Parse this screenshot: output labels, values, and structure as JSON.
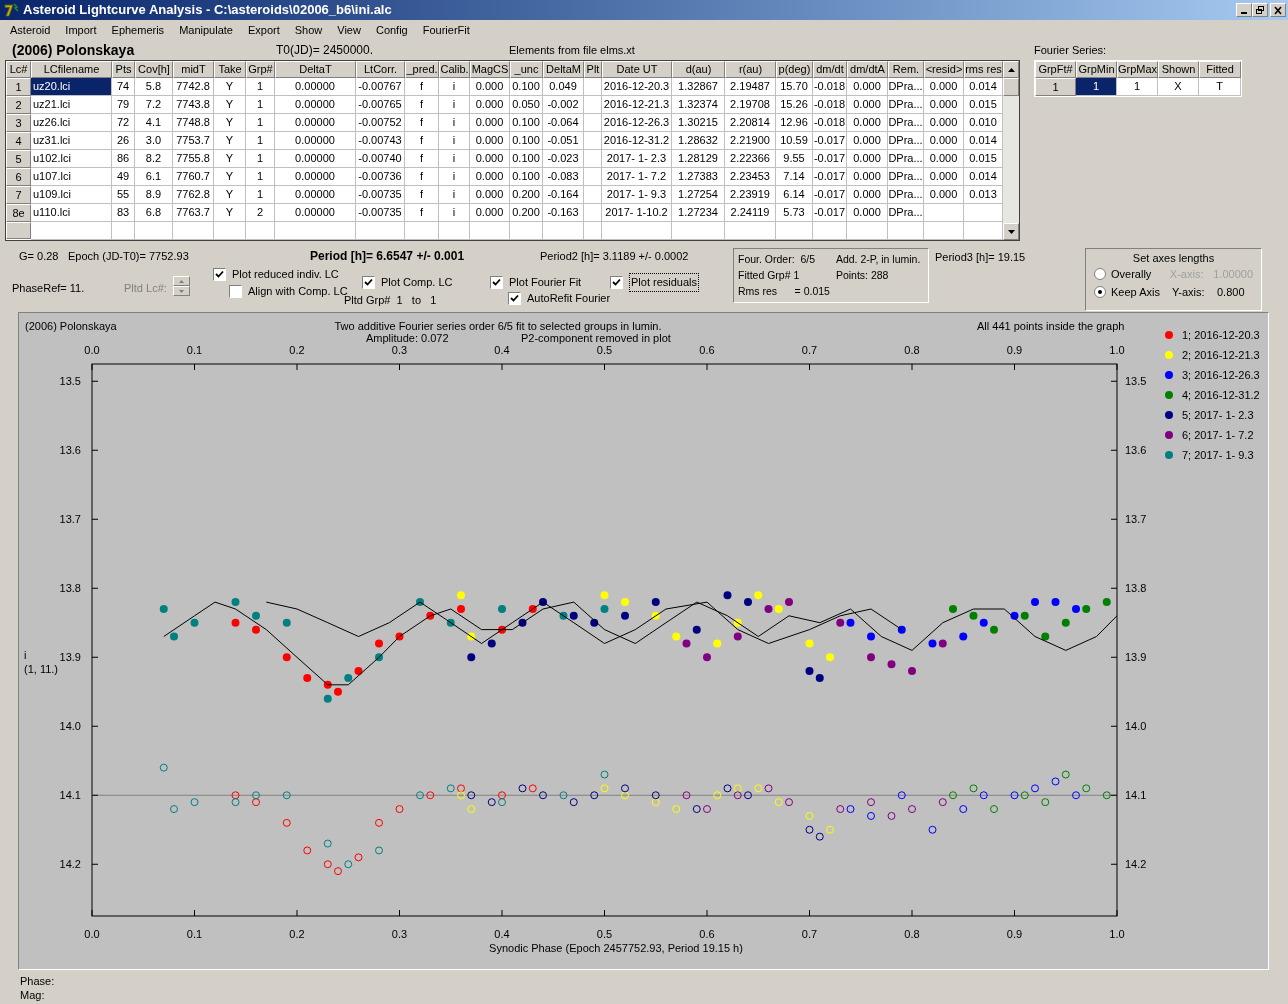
{
  "window": {
    "title": "Asteroid Lightcurve Analysis - C:\\asteroids\\02006_b6\\ini.alc"
  },
  "menu": [
    "Asteroid",
    "Import",
    "Ephemeris",
    "Manipulate",
    "Export",
    "Show",
    "View",
    "Config",
    "FourierFit"
  ],
  "header": {
    "object": "(2006) Polonskaya",
    "t0": "T0(JD)= 2450000.",
    "elements": "Elements from file elms.xt"
  },
  "table": {
    "columns": [
      "Lc#",
      "LCfilename",
      "Pts",
      "Cov[h]",
      "midT",
      "Take",
      "Grp#",
      "DeltaT",
      "LtCorr.",
      "_pred.",
      "Calib.",
      "MagCS",
      "_unc",
      "DeltaM",
      "Plt",
      "Date UT",
      "d(au)",
      "r(au)",
      "p(deg)",
      "dm/dt",
      "dm/dtA",
      "Rem.",
      "<resid>",
      "rms res"
    ],
    "rows": [
      {
        "selected": true,
        "cells": [
          "1",
          "uz20.lci",
          "74",
          "5.8",
          "7742.8",
          "Y",
          "1",
          "0.00000",
          "-0.00767",
          "f",
          "i",
          "0.000",
          "0.100",
          "0.049",
          "",
          "2016-12-20.3",
          "1.32867",
          "2.19487",
          "15.70",
          "-0.018",
          "0.000",
          "DPra...",
          "0.000",
          "0.014"
        ]
      },
      {
        "selected": false,
        "cells": [
          "2",
          "uz21.lci",
          "79",
          "7.2",
          "7743.8",
          "Y",
          "1",
          "0.00000",
          "-0.00765",
          "f",
          "i",
          "0.000",
          "0.050",
          "-0.002",
          "",
          "2016-12-21.3",
          "1.32374",
          "2.19708",
          "15.26",
          "-0.018",
          "0.000",
          "DPra...",
          "0.000",
          "0.015"
        ]
      },
      {
        "selected": false,
        "cells": [
          "3",
          "uz26.lci",
          "72",
          "4.1",
          "7748.8",
          "Y",
          "1",
          "0.00000",
          "-0.00752",
          "f",
          "i",
          "0.000",
          "0.100",
          "-0.064",
          "",
          "2016-12-26.3",
          "1.30215",
          "2.20814",
          "12.96",
          "-0.018",
          "0.000",
          "DPra...",
          "0.000",
          "0.010"
        ]
      },
      {
        "selected": false,
        "cells": [
          "4",
          "uz31.lci",
          "26",
          "3.0",
          "7753.7",
          "Y",
          "1",
          "0.00000",
          "-0.00743",
          "f",
          "i",
          "0.000",
          "0.100",
          "-0.051",
          "",
          "2016-12-31.2",
          "1.28632",
          "2.21900",
          "10.59",
          "-0.017",
          "0.000",
          "DPra...",
          "0.000",
          "0.014"
        ]
      },
      {
        "selected": false,
        "cells": [
          "5",
          "u102.lci",
          "86",
          "8.2",
          "7755.8",
          "Y",
          "1",
          "0.00000",
          "-0.00740",
          "f",
          "i",
          "0.000",
          "0.100",
          "-0.023",
          "",
          "2017- 1- 2.3",
          "1.28129",
          "2.22366",
          "9.55",
          "-0.017",
          "0.000",
          "DPra...",
          "0.000",
          "0.015"
        ]
      },
      {
        "selected": false,
        "cells": [
          "6",
          "u107.lci",
          "49",
          "6.1",
          "7760.7",
          "Y",
          "1",
          "0.00000",
          "-0.00736",
          "f",
          "i",
          "0.000",
          "0.100",
          "-0.083",
          "",
          "2017- 1- 7.2",
          "1.27383",
          "2.23453",
          "7.14",
          "-0.017",
          "0.000",
          "DPra...",
          "0.000",
          "0.014"
        ]
      },
      {
        "selected": false,
        "cells": [
          "7",
          "u109.lci",
          "55",
          "8.9",
          "7762.8",
          "Y",
          "1",
          "0.00000",
          "-0.00735",
          "f",
          "i",
          "0.000",
          "0.200",
          "-0.164",
          "",
          "2017- 1- 9.3",
          "1.27254",
          "2.23919",
          "6.14",
          "-0.017",
          "0.000",
          "DPra...",
          "0.000",
          "0.013"
        ]
      },
      {
        "selected": false,
        "cells": [
          "8e",
          "u110.lci",
          "83",
          "6.8",
          "7763.7",
          "Y",
          "2",
          "0.00000",
          "-0.00735",
          "f",
          "i",
          "0.000",
          "0.200",
          "-0.163",
          "",
          "2017- 1-10.2",
          "1.27234",
          "2.24119",
          "5.73",
          "-0.017",
          "0.000",
          "DPra...",
          "",
          ""
        ]
      }
    ]
  },
  "fourier": {
    "label": "Fourier Series:",
    "columns": [
      "GrpFt#",
      "GrpMin",
      "GrpMax",
      "Shown",
      "Fitted"
    ],
    "row": {
      "head": "1",
      "cells": [
        {
          "text": "1",
          "selected": true
        },
        {
          "text": "1",
          "selected": false
        },
        {
          "text": "X",
          "selected": false
        },
        {
          "text": "T",
          "selected": false
        }
      ]
    }
  },
  "info": {
    "g": "G= 0.28",
    "epoch": "Epoch (JD-T0)= 7752.93",
    "period": "Period [h]= 6.6547 +/- 0.001",
    "period2": "Period2 [h]= 3.1189 +/- 0.0002",
    "period3": "Period3 [h]= 19.15",
    "phaseref": "PhaseRef= 11.",
    "pltd_lc": {
      "label": "Pltd Lc#:",
      "disabled": true
    },
    "pltd_grp": "Pltd Grp#  1   to   1"
  },
  "checkboxes": [
    {
      "label": "Plot reduced indiv. LC",
      "checked": true
    },
    {
      "label": "Align with Comp. LC",
      "checked": false
    },
    {
      "label": "Plot Comp. LC",
      "checked": true
    },
    {
      "label": "Plot Fourier Fit",
      "checked": true
    },
    {
      "label": "AutoRefit Fourier",
      "checked": true
    },
    {
      "label": "Plot residuals",
      "checked": true
    }
  ],
  "fit_box": {
    "left": [
      "Four. Order:  6/5",
      "Fitted Grp# 1",
      "Rms res      = 0.015"
    ],
    "right": [
      "Add. 2-P, in lumin.",
      "Points: 288"
    ]
  },
  "axes": {
    "title": "Set axes lengths",
    "radios": [
      {
        "label": "Overally",
        "selected": false
      },
      {
        "label": "Keep Axis",
        "selected": true
      }
    ],
    "fields": [
      {
        "label": "X-axis:",
        "value": "1.00000",
        "disabled": true
      },
      {
        "label": "Y-axis:",
        "value": "0.800",
        "disabled": false
      }
    ]
  },
  "chart": {
    "chart_data": {
      "type": "scatter",
      "title": "Two additive Fourier series order 6/5 fit to selected groups in lumin.",
      "xlabel": "Synodic Phase (Epoch 2457752.93, Period 19.15 h)",
      "legend": "right",
      "xlim": [
        0,
        1
      ],
      "ylim": [
        14.275,
        13.475
      ],
      "xticks": [
        {
          "value": 0,
          "label": "0.0"
        },
        {
          "value": 0.1,
          "label": "0.1"
        },
        {
          "value": 0.2,
          "label": "0.2"
        },
        {
          "value": 0.3,
          "label": "0.3"
        },
        {
          "value": 0.4,
          "label": "0.4"
        },
        {
          "value": 0.5,
          "label": "0.5"
        },
        {
          "value": 0.6,
          "label": "0.6"
        },
        {
          "value": 0.7,
          "label": "0.7"
        },
        {
          "value": 0.8,
          "label": "0.8"
        },
        {
          "value": 0.9,
          "label": "0.9"
        },
        {
          "value": 1,
          "label": "1.0"
        }
      ],
      "yticks": [
        {
          "value": 13.5,
          "label": "13.5"
        },
        {
          "value": 13.6,
          "label": "13.6"
        },
        {
          "value": 13.7,
          "label": "13.7"
        },
        {
          "value": 13.8,
          "label": "13.8"
        },
        {
          "value": 13.9,
          "label": "13.9"
        },
        {
          "value": 14.0,
          "label": "14.0"
        },
        {
          "value": 14.1,
          "label": "14.1"
        },
        {
          "value": 14.2,
          "label": "14.2"
        }
      ],
      "annotations": [
        "(2006) Polonskaya",
        "Amplitude: 0.072",
        "P2-component removed in plot",
        "All 441 points inside the graph",
        "i",
        "(1, 11.)"
      ],
      "series": [
        {
          "type": "scatter",
          "name": "1; 2016-12-20.3",
          "color": "#ff0000",
          "x": [
            0.14,
            0.16,
            0.19,
            0.21,
            0.23,
            0.24,
            0.26,
            0.28,
            0.3,
            0.33,
            0.36,
            0.4,
            0.43
          ],
          "values": [
            13.85,
            13.86,
            13.9,
            13.93,
            13.94,
            13.95,
            13.92,
            13.88,
            13.87,
            13.84,
            13.83,
            13.86,
            13.83
          ]
        },
        {
          "type": "scatter",
          "name": "2; 2016-12-21.3",
          "color": "#ffff00",
          "x": [
            0.36,
            0.37,
            0.5,
            0.52,
            0.55,
            0.57,
            0.61,
            0.63,
            0.65,
            0.67,
            0.7,
            0.72
          ],
          "values": [
            13.81,
            13.87,
            13.81,
            13.82,
            13.84,
            13.87,
            13.88,
            13.85,
            13.81,
            13.83,
            13.88,
            13.9
          ]
        },
        {
          "type": "scatter",
          "name": "3; 2016-12-26.3",
          "color": "#0000ff",
          "x": [
            0.74,
            0.76,
            0.79,
            0.82,
            0.85,
            0.87,
            0.9,
            0.92,
            0.94,
            0.96
          ],
          "values": [
            13.85,
            13.87,
            13.86,
            13.88,
            13.87,
            13.85,
            13.84,
            13.82,
            13.82,
            13.83
          ]
        },
        {
          "type": "scatter",
          "name": "4; 2016-12-31.2",
          "color": "#008000",
          "x": [
            0.84,
            0.86,
            0.88,
            0.91,
            0.93,
            0.95,
            0.97,
            0.99
          ],
          "values": [
            13.83,
            13.84,
            13.86,
            13.84,
            13.87,
            13.85,
            13.83,
            13.82
          ]
        },
        {
          "type": "scatter",
          "name": "5; 2017- 1- 2.3",
          "color": "#000080",
          "x": [
            0.37,
            0.39,
            0.42,
            0.44,
            0.47,
            0.49,
            0.52,
            0.55,
            0.59,
            0.62,
            0.64,
            0.7,
            0.71
          ],
          "values": [
            13.9,
            13.88,
            13.85,
            13.82,
            13.84,
            13.85,
            13.84,
            13.82,
            13.86,
            13.81,
            13.82,
            13.92,
            13.93
          ]
        },
        {
          "type": "scatter",
          "name": "6; 2017- 1- 7.2",
          "color": "#800080",
          "x": [
            0.58,
            0.6,
            0.63,
            0.66,
            0.68,
            0.73,
            0.76,
            0.78,
            0.8,
            0.83
          ],
          "values": [
            13.88,
            13.9,
            13.87,
            13.83,
            13.82,
            13.85,
            13.9,
            13.91,
            13.92,
            13.88
          ]
        },
        {
          "type": "scatter",
          "name": "7; 2017- 1- 9.3",
          "color": "#008080",
          "x": [
            0.07,
            0.08,
            0.1,
            0.14,
            0.16,
            0.19,
            0.23,
            0.25,
            0.28,
            0.32,
            0.35,
            0.4,
            0.46,
            0.5
          ],
          "values": [
            13.83,
            13.87,
            13.85,
            13.82,
            13.84,
            13.85,
            13.96,
            13.93,
            13.9,
            13.82,
            13.85,
            13.83,
            13.84,
            13.83
          ]
        },
        {
          "type": "scatter",
          "color": "#ff0000",
          "x": [
            0.14,
            0.16,
            0.19,
            0.21,
            0.23,
            0.24,
            0.26,
            0.28,
            0.3,
            0.33,
            0.36,
            0.4,
            0.43
          ],
          "values": [
            14.1,
            14.11,
            14.14,
            14.18,
            14.2,
            14.21,
            14.19,
            14.14,
            14.12,
            14.1,
            14.09,
            14.1,
            14.09
          ]
        },
        {
          "type": "scatter",
          "color": "#ffff00",
          "x": [
            0.36,
            0.37,
            0.5,
            0.52,
            0.55,
            0.57,
            0.61,
            0.63,
            0.65,
            0.67,
            0.7,
            0.72
          ],
          "values": [
            14.1,
            14.12,
            14.09,
            14.1,
            14.11,
            14.12,
            14.1,
            14.09,
            14.09,
            14.11,
            14.13,
            14.15
          ]
        },
        {
          "type": "scatter",
          "color": "#0000ff",
          "x": [
            0.74,
            0.76,
            0.79,
            0.82,
            0.85,
            0.87,
            0.9,
            0.92,
            0.94,
            0.96
          ],
          "values": [
            14.12,
            14.13,
            14.1,
            14.15,
            14.12,
            14.1,
            14.1,
            14.09,
            14.08,
            14.1
          ]
        },
        {
          "type": "scatter",
          "color": "#008000",
          "x": [
            0.84,
            0.86,
            0.88,
            0.91,
            0.93,
            0.95,
            0.97,
            0.99
          ],
          "values": [
            14.1,
            14.09,
            14.12,
            14.1,
            14.11,
            14.07,
            14.09,
            14.1
          ]
        },
        {
          "type": "scatter",
          "color": "#000080",
          "x": [
            0.37,
            0.39,
            0.42,
            0.44,
            0.47,
            0.49,
            0.52,
            0.55,
            0.59,
            0.62,
            0.64,
            0.7,
            0.71
          ],
          "values": [
            14.1,
            14.11,
            14.09,
            14.1,
            14.11,
            14.1,
            14.09,
            14.1,
            14.12,
            14.09,
            14.1,
            14.15,
            14.16
          ]
        },
        {
          "type": "scatter",
          "color": "#800080",
          "x": [
            0.58,
            0.6,
            0.63,
            0.66,
            0.68,
            0.73,
            0.76,
            0.78,
            0.8,
            0.83
          ],
          "values": [
            14.1,
            14.12,
            14.1,
            14.09,
            14.11,
            14.12,
            14.11,
            14.13,
            14.12,
            14.11
          ]
        },
        {
          "type": "scatter",
          "color": "#008080",
          "x": [
            0.07,
            0.08,
            0.1,
            0.14,
            0.16,
            0.19,
            0.23,
            0.25,
            0.28,
            0.32,
            0.35,
            0.4,
            0.46,
            0.5
          ],
          "values": [
            14.06,
            14.12,
            14.11,
            14.11,
            14.1,
            14.1,
            14.17,
            14.2,
            14.18,
            14.1,
            14.09,
            14.11,
            14.1,
            14.07
          ]
        },
        {
          "type": "line",
          "color": "#000000",
          "x": [
            0.07,
            0.1,
            0.12,
            0.14,
            0.17,
            0.2,
            0.23,
            0.25,
            0.28,
            0.3,
            0.33,
            0.35,
            0.38,
            0.41,
            0.44,
            0.47,
            0.5,
            0.53,
            0.56,
            0.59,
            0.62,
            0.65,
            0.68,
            0.71,
            0.74,
            0.77,
            0.8,
            0.83,
            0.86,
            0.89,
            0.92,
            0.95,
            0.98,
            1.0
          ],
          "values": [
            13.87,
            13.84,
            13.82,
            13.83,
            13.86,
            13.9,
            13.94,
            13.94,
            13.9,
            13.87,
            13.84,
            13.83,
            13.86,
            13.86,
            13.83,
            13.82,
            13.86,
            13.88,
            13.85,
            13.82,
            13.84,
            13.87,
            13.84,
            13.85,
            13.83,
            13.87,
            13.89,
            13.85,
            13.83,
            13.83,
            13.87,
            13.89,
            13.87,
            13.84
          ]
        },
        {
          "type": "line",
          "color": "#000000",
          "x": [
            0.17,
            0.2,
            0.23,
            0.26,
            0.29,
            0.32,
            0.35,
            0.38,
            0.41,
            0.44,
            0.47,
            0.5,
            0.53,
            0.56,
            0.6,
            0.63,
            0.66,
            0.7,
            0.73,
            0.76,
            0.79
          ],
          "values": [
            13.82,
            13.83,
            13.85,
            13.87,
            13.85,
            13.82,
            13.85,
            13.88,
            13.85,
            13.82,
            13.85,
            13.88,
            13.86,
            13.83,
            13.82,
            13.86,
            13.88,
            13.86,
            13.84,
            13.83,
            13.86
          ]
        }
      ]
    }
  },
  "footer": [
    "Phase:",
    "Mag:"
  ]
}
